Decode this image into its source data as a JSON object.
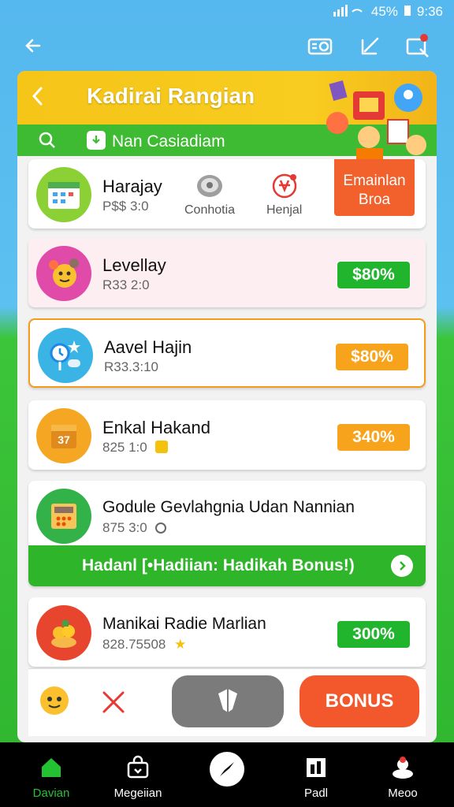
{
  "status_bar": {
    "battery": "45%",
    "time": "9:36"
  },
  "panel": {
    "title": "Kadirai Rangian",
    "search_label": "Nan Casiadiam"
  },
  "cards": [
    {
      "name": "Harajay",
      "sub": "P$$ 3:0",
      "mini_left": "Conhotia",
      "mini_right": "Henjal",
      "action": "Emainlan Broa"
    },
    {
      "name": "Levellay",
      "sub": "R33 2:0",
      "action": "$80%"
    },
    {
      "name": "Aavel Hajin",
      "sub": "R33.3:10",
      "action": "$80%"
    },
    {
      "name": "Enkal Hakand",
      "sub": "825 1:0",
      "action": "340%"
    },
    {
      "name": "Godule Gevlahgnia Udan Nannian",
      "sub": "875 3:0"
    },
    {
      "name": "Manikai Radie Marlian",
      "sub": "828.75508",
      "action": "300%"
    }
  ],
  "banner": {
    "text": "Hadanl [•Hadiian: Hadikah Bonus!)"
  },
  "action_bar": {
    "bonus_label": "BONUS"
  },
  "nav": [
    {
      "label": "Davian",
      "icon": "home-icon"
    },
    {
      "label": "Megeiian",
      "icon": "bag-icon"
    },
    {
      "label": "",
      "icon": "compass-icon"
    },
    {
      "label": "Padl",
      "icon": "chart-icon"
    },
    {
      "label": "Meoo",
      "icon": "profile-icon"
    }
  ],
  "colors": {
    "accent_green": "#21b52e",
    "accent_orange": "#f8a31c",
    "header_yellow": "#f5c518",
    "bonus_red": "#f2582b"
  }
}
